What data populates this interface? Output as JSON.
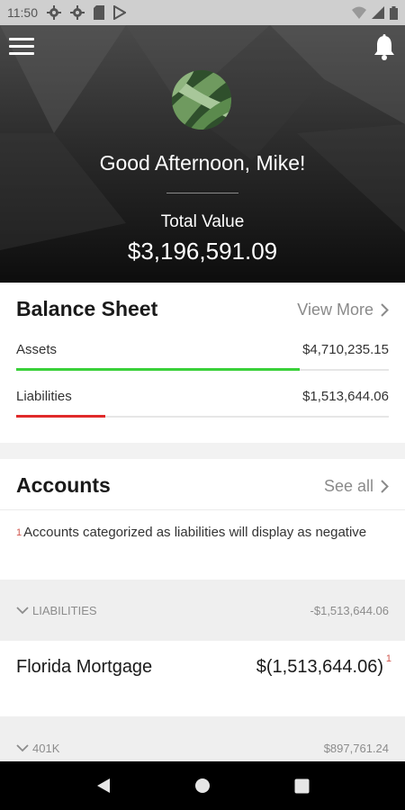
{
  "status_bar": {
    "time": "11:50",
    "icons": [
      "gear-icon",
      "gear-icon",
      "sd-card-icon",
      "play-store-icon",
      "wifi-icon",
      "signal-icon",
      "battery-icon"
    ]
  },
  "header": {
    "menu_icon": "hamburger-menu-icon",
    "notification_icon": "bell-icon",
    "avatar_icon": "profile-avatar",
    "greeting": "Good Afternoon, Mike!",
    "total_label": "Total Value",
    "total_value": "$3,196,591.09"
  },
  "balance_sheet": {
    "title": "Balance Sheet",
    "link": "View More",
    "rows": [
      {
        "label": "Assets",
        "value": "$4,710,235.15",
        "fill_fraction": 0.76,
        "color": "#3ad13a"
      },
      {
        "label": "Liabilities",
        "value": "$1,513,644.06",
        "fill_fraction": 0.24,
        "color": "#e02a2a"
      }
    ]
  },
  "accounts": {
    "title": "Accounts",
    "link": "See all",
    "note_marker": "1",
    "note": "Accounts categorized as liabilities will display as negative",
    "groups": [
      {
        "label": "LIABILITIES",
        "value": "-$1,513,644.06"
      },
      {
        "label": "401K",
        "value": "$897,761.24"
      }
    ],
    "items": [
      {
        "name": "Florida Mortgage",
        "value": "$(1,513,644.06)",
        "marker": "1"
      }
    ]
  },
  "nav": {
    "back_icon": "back-triangle-icon",
    "home_icon": "home-circle-icon",
    "recents_icon": "recents-square-icon"
  }
}
